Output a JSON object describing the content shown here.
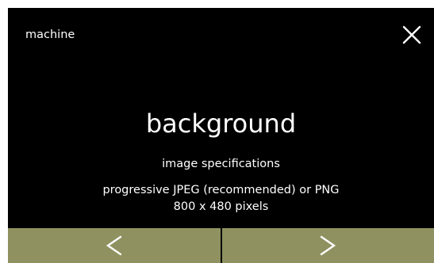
{
  "header": {
    "title": "machine",
    "close_icon": "close-icon"
  },
  "main": {
    "title": "background",
    "subtitle": "image specifications",
    "spec_lines": [
      "progressive JPEG (recommended) or PNG",
      "800 x 480 pixels"
    ]
  },
  "nav": {
    "prev_icon": "chevron-left-icon",
    "next_icon": "chevron-right-icon",
    "bar_color": "#8f9160"
  },
  "colors": {
    "background": "#000000",
    "text": "#ffffff"
  }
}
